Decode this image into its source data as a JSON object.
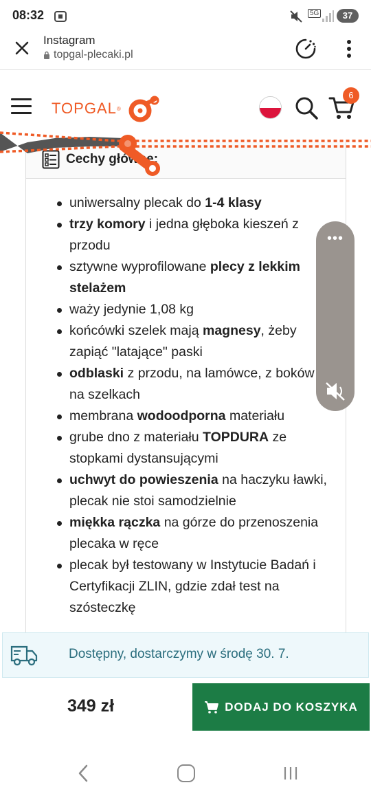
{
  "status_bar": {
    "time": "08:32",
    "network": "5G",
    "battery": "37"
  },
  "browser": {
    "title": "Instagram",
    "url": "topgal-plecaki.pl"
  },
  "header": {
    "logo_text": "TOPGAL",
    "logo_reg": "®",
    "cart_count": "6"
  },
  "card": {
    "title": "Cechy główne:"
  },
  "features": [
    {
      "parts": [
        {
          "t": "uniwersalny plecak do ",
          "b": false
        },
        {
          "t": "1-4 klasy",
          "b": true
        }
      ]
    },
    {
      "parts": [
        {
          "t": "trzy komory",
          "b": true
        },
        {
          "t": " i jedna głęboka kieszeń z przodu",
          "b": false
        }
      ]
    },
    {
      "parts": [
        {
          "t": "sztywne wyprofilowane ",
          "b": false
        },
        {
          "t": "plecy z lekkim stelażem",
          "b": true
        }
      ]
    },
    {
      "parts": [
        {
          "t": "waży jedynie 1,08 kg",
          "b": false
        }
      ]
    },
    {
      "parts": [
        {
          "t": "końcówki szelek mają ",
          "b": false
        },
        {
          "t": "magnesy",
          "b": true
        },
        {
          "t": ", żeby zapiąć \"latające\" paski",
          "b": false
        }
      ]
    },
    {
      "parts": [
        {
          "t": "odblaski",
          "b": true
        },
        {
          "t": " z przodu, na lamówce, z boków i na szelkach",
          "b": false
        }
      ]
    },
    {
      "parts": [
        {
          "t": "membrana ",
          "b": false
        },
        {
          "t": "wodoodporna",
          "b": true
        },
        {
          "t": " materiału",
          "b": false
        }
      ]
    },
    {
      "parts": [
        {
          "t": "grube dno z materiału ",
          "b": false
        },
        {
          "t": "TOPDURA",
          "b": true
        },
        {
          "t": " ze stopkami dystansującymi",
          "b": false
        }
      ]
    },
    {
      "parts": [
        {
          "t": "uchwyt do powieszenia",
          "b": true
        },
        {
          "t": " na haczyku ławki, plecak nie stoi samodzielnie",
          "b": false
        }
      ]
    },
    {
      "parts": [
        {
          "t": "miękka rączka",
          "b": true
        },
        {
          "t": " na górze do przenoszenia plecaka w ręce",
          "b": false
        }
      ]
    },
    {
      "parts": [
        {
          "t": "plecak był testowany w Instytucie Badań i Certyfikacji ZLIN, gdzie zdał test na szósteczkę",
          "b": false
        }
      ]
    }
  ],
  "availability": {
    "text": "Dostępny, dostarczymy w środę 30. 7."
  },
  "buy": {
    "price": "349 zł",
    "add_label": "DODAJ DO KOSZYKA"
  },
  "colors": {
    "brand_orange": "#ef5b26",
    "buy_green": "#1c7c45",
    "avail_text": "#2b6e7e"
  },
  "icons": [
    "close-icon",
    "lock-icon",
    "timer-icon",
    "more-vert-icon",
    "hamburger-icon",
    "search-icon",
    "cart-icon",
    "checklist-icon",
    "mute-icon",
    "truck-icon",
    "back-icon",
    "home-icon",
    "recents-icon"
  ]
}
